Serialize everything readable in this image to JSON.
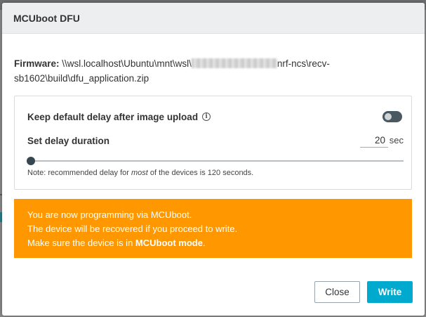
{
  "dialog": {
    "title": "MCUboot DFU"
  },
  "firmware": {
    "label": "Firmware:",
    "path_start": "\\\\wsl.localhost\\Ubuntu\\mnt\\wsl\\",
    "path_end": "nrf-ncs\\recv-sb1602\\build\\dfu_application.zip"
  },
  "settings": {
    "keep_delay_label": "Keep default delay after image upload",
    "keep_delay_enabled": false,
    "set_delay_label": "Set delay duration",
    "delay_value": "20",
    "delay_unit": "sec",
    "slider_fraction": 0.0,
    "note_prefix": "Note: recommended delay for ",
    "note_emph": "most",
    "note_suffix": " of the devices is 120 seconds."
  },
  "warning": {
    "line1": "You are now programming via MCUboot.",
    "line2": "The device will be recovered if you proceed to write.",
    "line3_prefix": "Make sure the device is in ",
    "line3_bold": "MCUboot mode",
    "line3_suffix": "."
  },
  "buttons": {
    "close_label": "Close",
    "write_label": "Write"
  },
  "colors": {
    "warning_bg": "#ff9800",
    "primary": "#00a9ce",
    "toggle_off": "#4a5961"
  },
  "icons": {
    "info": "info-circle-icon"
  }
}
